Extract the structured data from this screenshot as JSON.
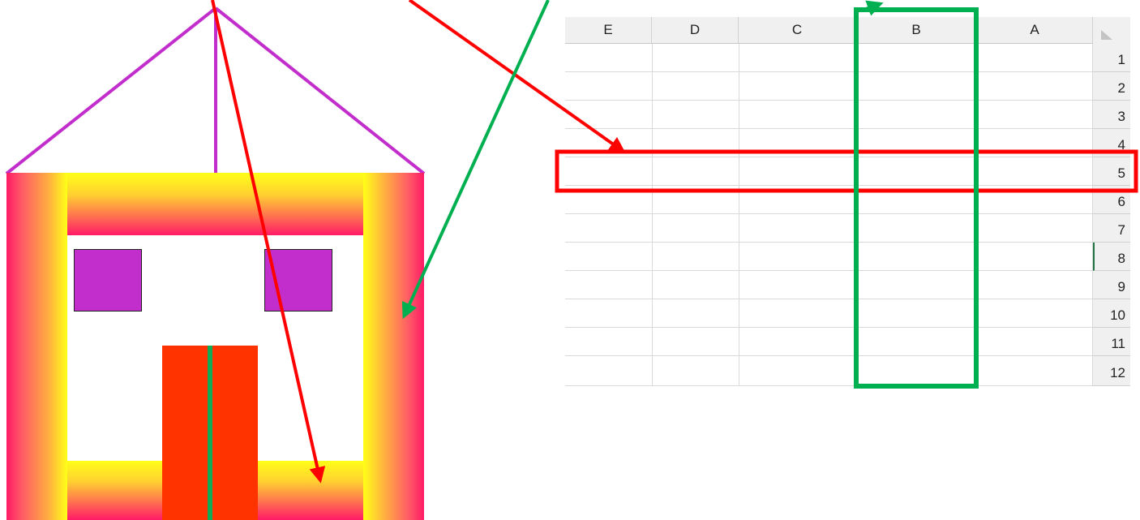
{
  "spreadsheet": {
    "columns": [
      "E",
      "D",
      "C",
      "B",
      "A"
    ],
    "rows": [
      "1",
      "2",
      "3",
      "4",
      "5",
      "6",
      "7",
      "8",
      "9",
      "10",
      "11",
      "12"
    ],
    "highlighted_row": "5",
    "highlighted_column": "B"
  },
  "colors": {
    "roof": "#c22ecc",
    "window": "#c22ecc",
    "door": "#ff3300",
    "door_seam": "#11aa55",
    "frame_pink": "#ff1a66",
    "frame_yellow": "#ffff18",
    "row_highlight": "#ff0000",
    "column_highlight": "#00b050",
    "arrow_red": "#ff0000",
    "arrow_green": "#00b050"
  }
}
